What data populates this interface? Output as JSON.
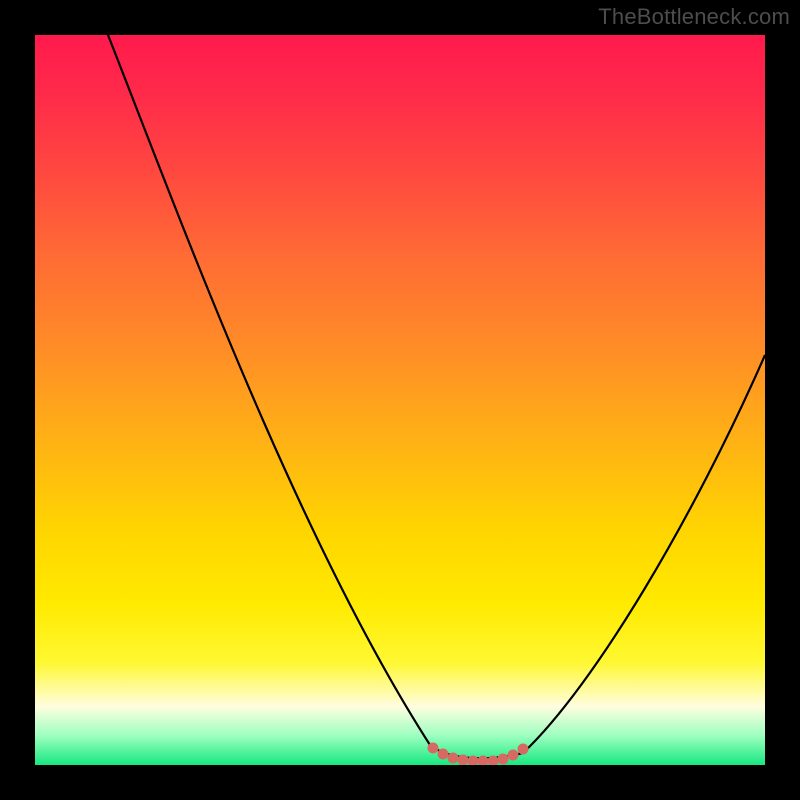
{
  "watermark": "TheBottleneck.com",
  "colors": {
    "frame": "#000000",
    "gradient_top": "#ff1a4d",
    "gradient_bottom": "#17e881",
    "curve": "#000000",
    "marker": "#d66a63"
  },
  "chart_data": {
    "type": "line",
    "title": "",
    "xlabel": "",
    "ylabel": "",
    "xlim": [
      0,
      100
    ],
    "ylim": [
      0,
      100
    ],
    "series": [
      {
        "name": "bottleneck-curve",
        "x": [
          10,
          15,
          20,
          25,
          30,
          35,
          40,
          45,
          50,
          52,
          54,
          56,
          58,
          60,
          62,
          64,
          66,
          70,
          75,
          80,
          85,
          90,
          95,
          100
        ],
        "y": [
          100,
          90,
          80,
          70,
          60,
          50,
          40,
          30,
          18,
          12,
          8,
          5,
          2,
          1,
          0.5,
          0.5,
          1,
          4,
          12,
          22,
          33,
          43,
          52,
          60
        ]
      }
    ],
    "markers": [
      {
        "name": "minimum-region",
        "x": [
          56,
          58,
          60,
          62,
          64,
          66
        ],
        "y": [
          5,
          2,
          1,
          0.5,
          0.5,
          1
        ]
      }
    ],
    "annotations": []
  }
}
